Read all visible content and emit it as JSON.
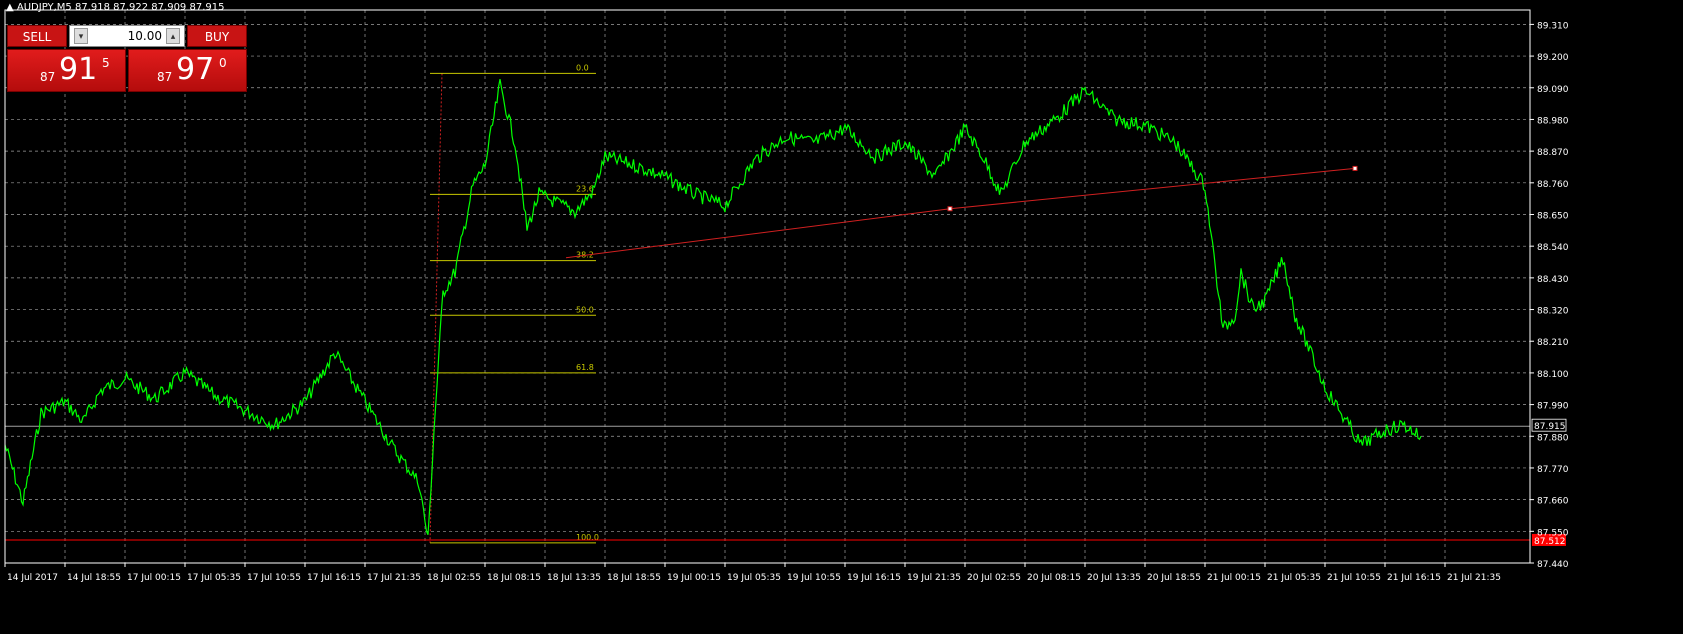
{
  "symbol_header": "AUDJPY,M5  87.918 87.922 87.909 87.915",
  "trade_panel": {
    "sell_label": "SELL",
    "buy_label": "BUY",
    "lot_value": "10.00",
    "sell_price": {
      "prefix": "87",
      "big": "91",
      "pip": "5"
    },
    "buy_price": {
      "prefix": "87",
      "big": "97",
      "pip": "0"
    }
  },
  "colors": {
    "background": "#000000",
    "price_line": "#00ff00",
    "grid": "#a0a0a0",
    "fibo": "#c8c800",
    "trendline": "#d02020",
    "bid_line": "#a0a0a0",
    "alert_line": "#ff0000",
    "trade_button": "#c81414"
  },
  "chart_data": {
    "type": "line",
    "symbol": "AUDJPY",
    "timeframe": "M5",
    "ylim": [
      87.44,
      89.36
    ],
    "y_ticks": [
      89.31,
      89.2,
      89.09,
      88.98,
      88.87,
      88.76,
      88.65,
      88.54,
      88.43,
      88.32,
      88.21,
      88.1,
      87.99,
      87.88,
      87.77,
      87.66,
      87.55,
      87.44
    ],
    "y_tick_labels": [
      "89.310",
      "89.200",
      "89.090",
      "88.980",
      "88.870",
      "88.760",
      "88.650",
      "88.540",
      "88.430",
      "88.320",
      "88.210",
      "88.100",
      "87.990",
      "87.880",
      "87.770",
      "87.660",
      "87.550",
      "87.440"
    ],
    "x_tick_labels": [
      "14 Jul 2017",
      "14 Jul 18:55",
      "17 Jul 00:15",
      "17 Jul 05:35",
      "17 Jul 10:55",
      "17 Jul 16:15",
      "17 Jul 21:35",
      "18 Jul 02:55",
      "18 Jul 08:15",
      "18 Jul 13:35",
      "18 Jul 18:55",
      "19 Jul 00:15",
      "19 Jul 05:35",
      "19 Jul 10:55",
      "19 Jul 16:15",
      "19 Jul 21:35",
      "20 Jul 02:55",
      "20 Jul 08:15",
      "20 Jul 13:35",
      "20 Jul 18:55",
      "21 Jul 00:15",
      "21 Jul 05:35",
      "21 Jul 10:55",
      "21 Jul 16:15",
      "21 Jul 21:35"
    ],
    "x": [
      0,
      0.3,
      0.6,
      1,
      1.3,
      1.6,
      2,
      2.5,
      3,
      3.5,
      4,
      4.5,
      5,
      5.5,
      6,
      6.5,
      6.9,
      7.05,
      7.15,
      7.3,
      7.5,
      7.8,
      8,
      8.25,
      8.5,
      8.7,
      8.9,
      9.1,
      9.3,
      9.5,
      9.8,
      10,
      10.5,
      11,
      11.5,
      12,
      12.5,
      13,
      13.5,
      14,
      14.5,
      15,
      15.5,
      16,
      16.3,
      16.6,
      17,
      17.5,
      18,
      18.5,
      19,
      19.5,
      20,
      20.3,
      20.5,
      20.6,
      20.8,
      21,
      21.3,
      21.5,
      21.8,
      22,
      22.3,
      22.6,
      23,
      23.3,
      23.6
    ],
    "y": [
      87.85,
      87.65,
      87.96,
      88.0,
      87.93,
      88.04,
      88.08,
      88.01,
      88.1,
      88.02,
      87.97,
      87.92,
      88.0,
      88.17,
      88.0,
      87.83,
      87.72,
      87.52,
      87.9,
      88.38,
      88.45,
      88.75,
      88.82,
      89.1,
      88.9,
      88.6,
      88.72,
      88.7,
      88.68,
      88.66,
      88.73,
      88.85,
      88.82,
      88.78,
      88.72,
      88.68,
      88.84,
      88.92,
      88.9,
      88.95,
      88.85,
      88.9,
      88.78,
      88.95,
      88.85,
      88.72,
      88.9,
      88.98,
      89.08,
      88.98,
      88.96,
      88.9,
      88.75,
      88.25,
      88.3,
      88.45,
      88.32,
      88.35,
      88.5,
      88.3,
      88.15,
      88.05,
      87.95,
      87.85,
      87.9,
      87.92,
      87.88
    ],
    "fibonacci": {
      "levels": [
        "0.0",
        "23.6",
        "38.2",
        "50.0",
        "61.8",
        "100.0"
      ],
      "prices": [
        89.14,
        88.72,
        88.49,
        88.3,
        88.1,
        87.51
      ]
    },
    "trendline": [
      [
        9.35,
        88.5
      ],
      [
        15.75,
        88.67
      ],
      [
        22.5,
        88.81
      ]
    ],
    "bid_price": 87.915,
    "bid_label": "87.915",
    "alert_price": 87.52,
    "alert_label": "87.512"
  }
}
